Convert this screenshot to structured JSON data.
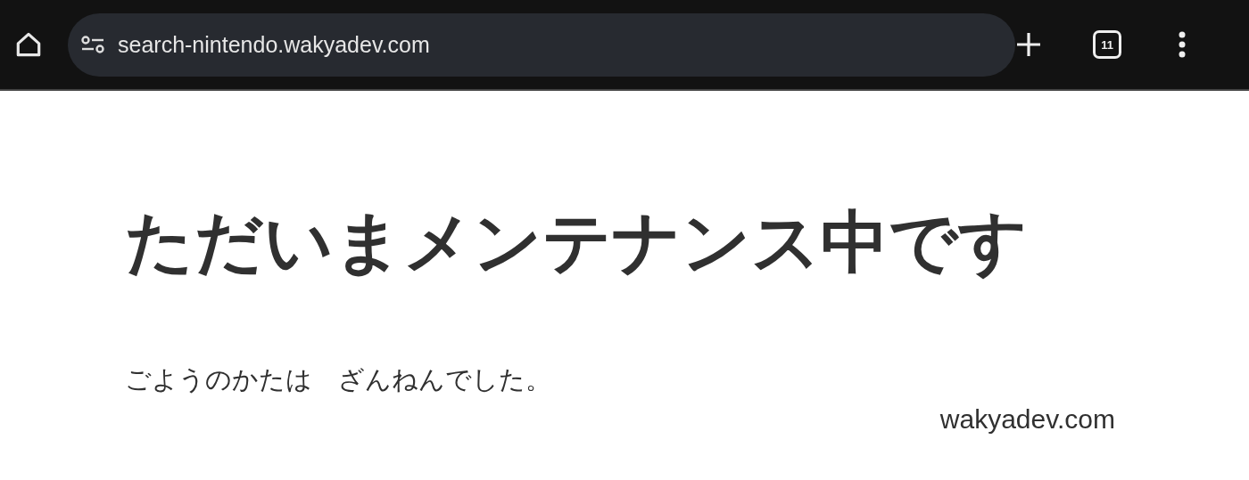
{
  "toolbar": {
    "url": "search-nintendo.wakyadev.com",
    "tab_count": "11"
  },
  "page": {
    "heading": "ただいまメンテナンス中です",
    "message": "ごようのかたは　ざんねんでした。",
    "footer": "wakyadev.com"
  }
}
